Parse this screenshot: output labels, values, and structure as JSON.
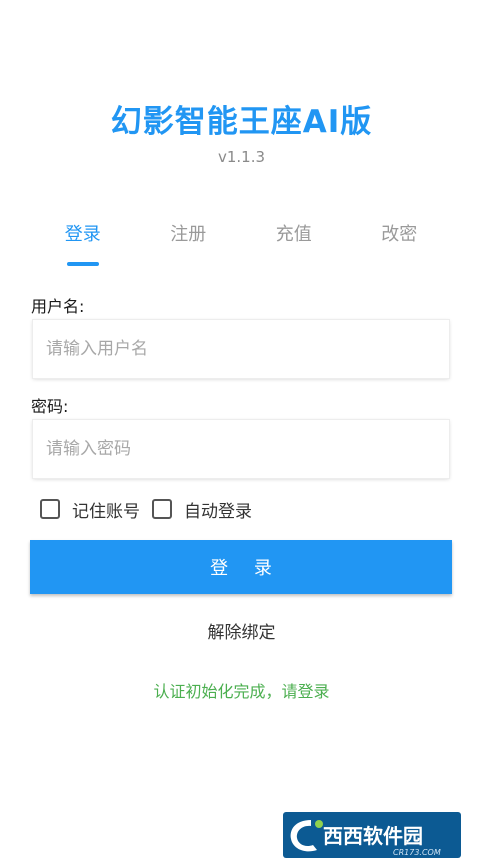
{
  "app": {
    "title": "幻影智能王座AI版",
    "version": "v1.1.3"
  },
  "tabs": [
    {
      "label": "登录",
      "active": true
    },
    {
      "label": "注册",
      "active": false
    },
    {
      "label": "充值",
      "active": false
    },
    {
      "label": "改密",
      "active": false
    }
  ],
  "form": {
    "username_label": "用户名:",
    "username_placeholder": "请输入用户名",
    "username_value": "",
    "password_label": "密码:",
    "password_placeholder": "请输入密码",
    "password_value": "",
    "remember_label": "记住账号",
    "remember_checked": false,
    "autologin_label": "自动登录",
    "autologin_checked": false,
    "login_button": "登 录",
    "unbind_link": "解除绑定",
    "status": "认证初始化完成，请登录"
  },
  "watermark": {
    "brand": "西西软件园",
    "site": "CR173.COM"
  },
  "colors": {
    "accent": "#2196f3",
    "status_green": "#4caf50",
    "tab_inactive": "#9a9a9a",
    "watermark_bg": "#0c5a93"
  }
}
